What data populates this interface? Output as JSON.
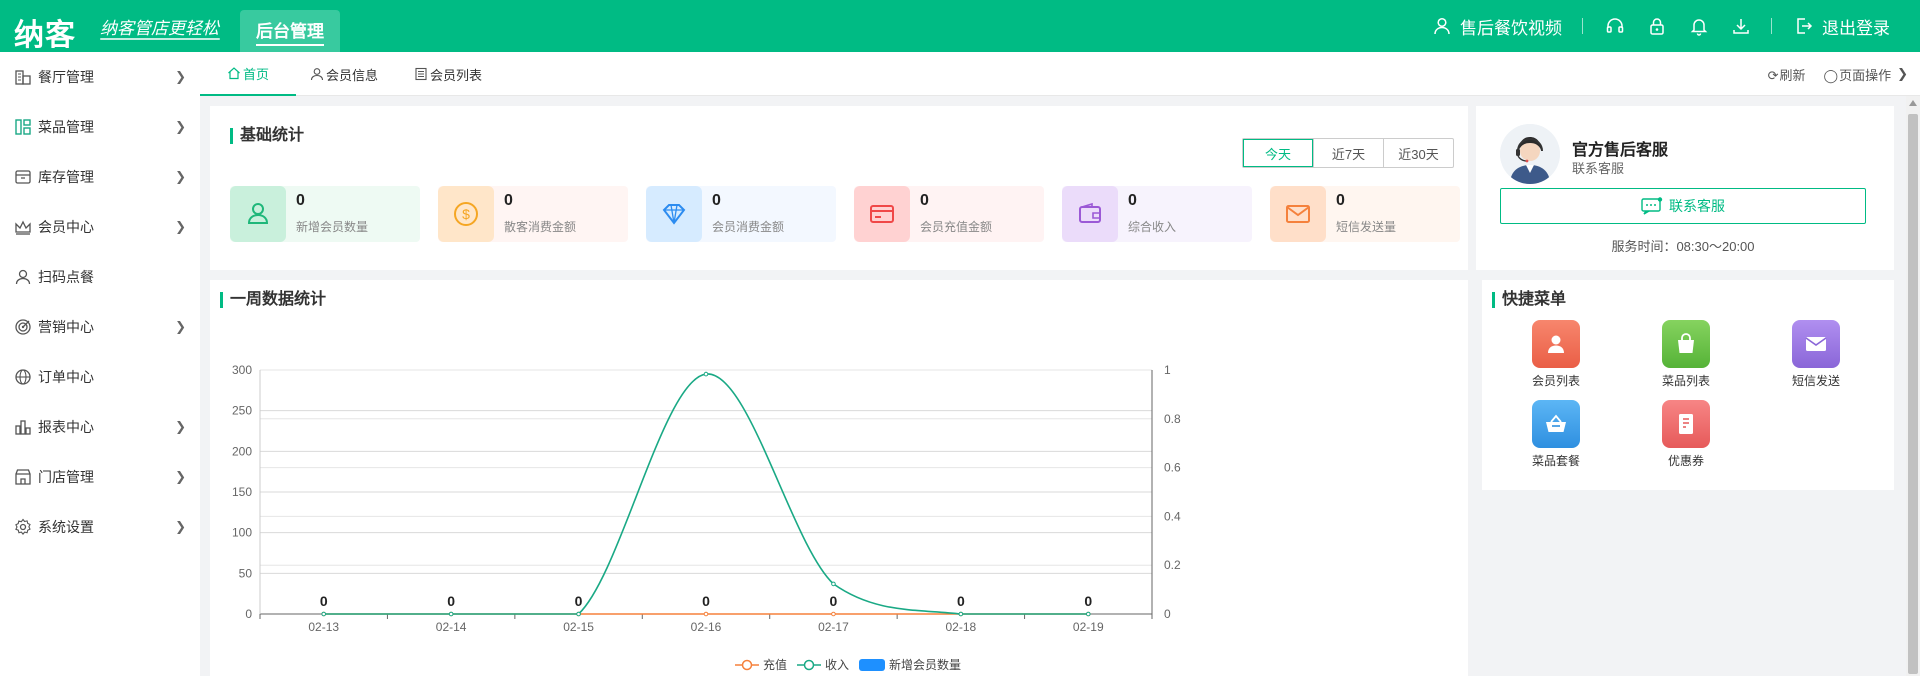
{
  "header": {
    "logo": "纳客",
    "slogan": "纳客管店更轻松",
    "module_tab": "后台管理",
    "user_name": "售后餐饮视频",
    "logout_label": "退出登录",
    "icons": [
      "user-icon",
      "headset-icon",
      "lock-icon",
      "bell-icon",
      "download-icon",
      "logout-icon"
    ]
  },
  "sidebar": {
    "items": [
      {
        "label": "餐厅管理",
        "icon": "building-icon",
        "has_children": true
      },
      {
        "label": "菜品管理",
        "icon": "grid-icon",
        "has_children": true
      },
      {
        "label": "库存管理",
        "icon": "archive-icon",
        "has_children": true
      },
      {
        "label": "会员中心",
        "icon": "crown-icon",
        "has_children": true
      },
      {
        "label": "扫码点餐",
        "icon": "user-icon",
        "has_children": false
      },
      {
        "label": "营销中心",
        "icon": "target-icon",
        "has_children": true
      },
      {
        "label": "订单中心",
        "icon": "globe-icon",
        "has_children": false
      },
      {
        "label": "报表中心",
        "icon": "bar-chart-icon",
        "has_children": true
      },
      {
        "label": "门店管理",
        "icon": "store-icon",
        "has_children": true
      },
      {
        "label": "系统设置",
        "icon": "gear-icon",
        "has_children": true
      }
    ]
  },
  "tabs": {
    "items": [
      {
        "label": "首页",
        "active": true
      },
      {
        "label": "会员信息",
        "active": false
      },
      {
        "label": "会员列表",
        "active": false
      }
    ],
    "refresh": "刷新",
    "page_ops": "页面操作"
  },
  "stats": {
    "title": "基础统计",
    "ranges": [
      "今天",
      "近7天",
      "近30天"
    ],
    "selected_range": "今天",
    "items": [
      {
        "value": "0",
        "label": "新增会员数量",
        "icon": "user-add-icon",
        "bg": "#eefaf3",
        "icon_bg": "#c9f0dc",
        "color": "#1fb77a"
      },
      {
        "value": "0",
        "label": "散客消费金额",
        "icon": "coin-icon",
        "bg": "#fff5f3",
        "icon_bg": "#ffe6c9",
        "color": "#f5a623"
      },
      {
        "value": "0",
        "label": "会员消费金额",
        "icon": "diamond-icon",
        "bg": "#f3f8ff",
        "icon_bg": "#d6ebff",
        "color": "#2d8cf0"
      },
      {
        "value": "0",
        "label": "会员充值金额",
        "icon": "card-icon",
        "bg": "#fff3f3",
        "icon_bg": "#ffd2d2",
        "color": "#f04848"
      },
      {
        "value": "0",
        "label": "综合收入",
        "icon": "wallet-icon",
        "bg": "#f7f3fd",
        "icon_bg": "#ebdcfa",
        "color": "#9b59d6"
      },
      {
        "value": "0",
        "label": "短信发送量",
        "icon": "mail-icon",
        "bg": "#fff6f0",
        "icon_bg": "#ffdfc9",
        "color": "#f5813c"
      }
    ]
  },
  "service": {
    "name": "官方售后客服",
    "sub": "联系客服",
    "button": "联系客服",
    "hours": "服务时间：08:30～20:00"
  },
  "weekly": {
    "title": "一周数据统计"
  },
  "chart_data": {
    "type": "line",
    "categories": [
      "02-13",
      "02-14",
      "02-15",
      "02-16",
      "02-17",
      "02-18",
      "02-19"
    ],
    "series": [
      {
        "name": "充值",
        "type": "line",
        "axis": "left",
        "color": "#f5813c",
        "values": [
          0,
          0,
          0,
          0,
          0,
          0,
          0
        ]
      },
      {
        "name": "收入",
        "type": "line",
        "axis": "left",
        "color": "#1aa985",
        "values": [
          0,
          0,
          0,
          295,
          37,
          0,
          0
        ]
      },
      {
        "name": "新增会员数量",
        "type": "bar",
        "axis": "right",
        "color": "#1e90ff",
        "values": [
          0,
          0,
          0,
          0,
          0,
          0,
          0
        ]
      }
    ],
    "data_labels": [
      "0",
      "0",
      "0",
      "0",
      "0",
      "0",
      "0"
    ],
    "yticks_left": [
      "0",
      "50",
      "100",
      "150",
      "200",
      "250",
      "300"
    ],
    "yticks_right": [
      "0",
      "0.2",
      "0.4",
      "0.6",
      "0.8",
      "1"
    ],
    "ylim_left": [
      0,
      300
    ],
    "ylim_right": [
      0,
      1
    ],
    "grid": true,
    "legend": "bottom-center"
  },
  "quick_menu": {
    "title": "快捷菜单",
    "items": [
      {
        "label": "会员列表",
        "icon": "member-icon",
        "color": "#f0725a"
      },
      {
        "label": "菜品列表",
        "icon": "shopping-bag-icon",
        "color": "#6bc04b"
      },
      {
        "label": "短信发送",
        "icon": "envelope-icon",
        "color": "#9b7be0"
      },
      {
        "label": "菜品套餐",
        "icon": "basket-icon",
        "color": "#3fa3f0"
      },
      {
        "label": "优惠券",
        "icon": "coupon-icon",
        "color": "#f06c6c"
      }
    ]
  }
}
